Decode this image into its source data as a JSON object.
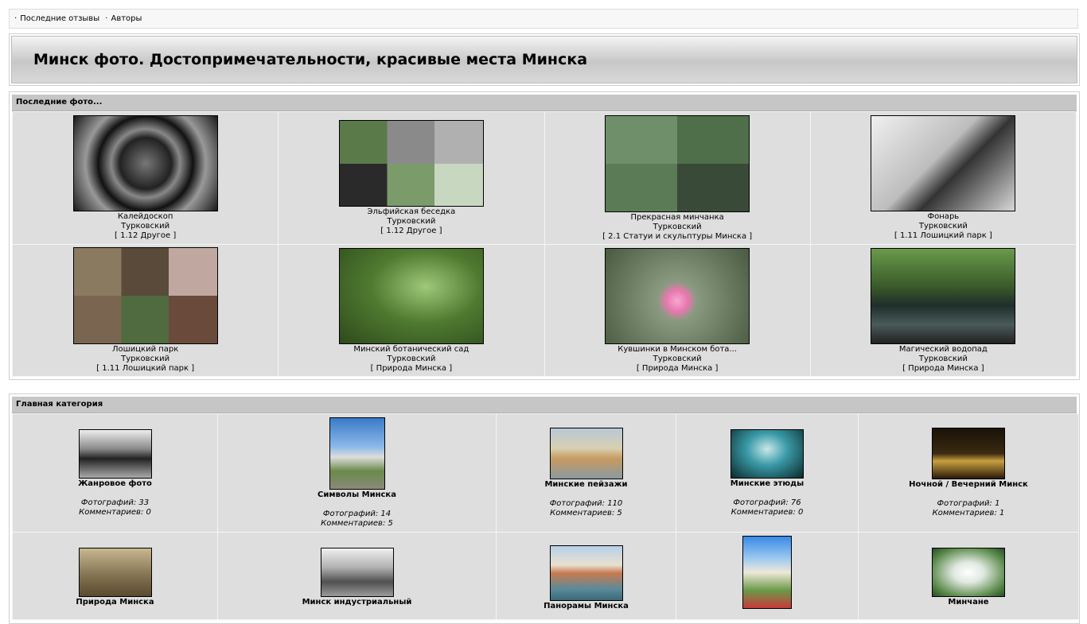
{
  "nav": {
    "bullet": "·",
    "links": [
      "Последние отзывы",
      "Авторы"
    ]
  },
  "header": {
    "title": "Минск фото. Достопримечательности, красивые места Минска"
  },
  "recent": {
    "title": "Последние фото...",
    "items": [
      {
        "name": "Калейдоскоп",
        "author": "Турковский",
        "category": "[ 1.12 Другое ]",
        "thumb": "wrought-iron-dome-photo"
      },
      {
        "name": "Эльфийская беседка",
        "author": "Турковский",
        "category": "[ 1.12 Другое ]",
        "thumb": "gazebo-collage-photo"
      },
      {
        "name": "Прекрасная минчанка",
        "author": "Турковский",
        "category": "[ 2.1 Статуи и скульптуры Минска ]",
        "thumb": "statue-collage-photo"
      },
      {
        "name": "Фонарь",
        "author": "Турковский",
        "category": "[ 1.11 Лошицкий парк ]",
        "thumb": "street-lamps-photo"
      },
      {
        "name": "Лошицкий парк",
        "author": "Турковский",
        "category": "[ 1.11 Лошицкий парк ]",
        "thumb": "park-collage-photo"
      },
      {
        "name": "Минский ботанический сад",
        "author": "Турковский",
        "category": "[ Природа Минска ]",
        "thumb": "botanical-garden-photo"
      },
      {
        "name": "Кувшинки в Минском бота...",
        "author": "Турковский",
        "category": "[ Природа Минска ]",
        "thumb": "water-lily-photo"
      },
      {
        "name": "Магический водопад",
        "author": "Турковский",
        "category": "[ Природа Минска ]",
        "thumb": "waterfall-forest-photo"
      }
    ]
  },
  "categories": {
    "title": "Главная категория",
    "stat_photos_label": "Фотографий:",
    "stat_comments_label": "Комментариев:",
    "items": [
      {
        "name": "Жанровое фото",
        "photos": "33",
        "comments": "0",
        "thumb": "genre-photo-thumb"
      },
      {
        "name": "Символы Минска",
        "photos": "14",
        "comments": "5",
        "thumb": "minsk-symbols-thumb"
      },
      {
        "name": "Минские пейзажи",
        "photos": "110",
        "comments": "5",
        "thumb": "minsk-landscapes-thumb"
      },
      {
        "name": "Минские этюды",
        "photos": "76",
        "comments": "0",
        "thumb": "minsk-etudes-thumb"
      },
      {
        "name": "Ночной / Вечерний Минск",
        "photos": "1",
        "comments": "1",
        "thumb": "night-minsk-thumb"
      },
      {
        "name": "Природа Минска",
        "thumb": "nature-minsk-thumb"
      },
      {
        "name": "Минск индустриальный",
        "thumb": "industrial-minsk-thumb"
      },
      {
        "name": "Панорамы Минска",
        "thumb": "minsk-panoramas-thumb"
      },
      {
        "name": "",
        "thumb": "church-thumb"
      },
      {
        "name": "Минчане",
        "thumb": "minsk-people-thumb"
      }
    ]
  },
  "colors": {
    "header_gradient_top": "#f3f3f3",
    "header_gradient_mid": "#c8c8c8",
    "section_title_bg": "#c6c6c6",
    "cell_bg": "#dedede"
  }
}
